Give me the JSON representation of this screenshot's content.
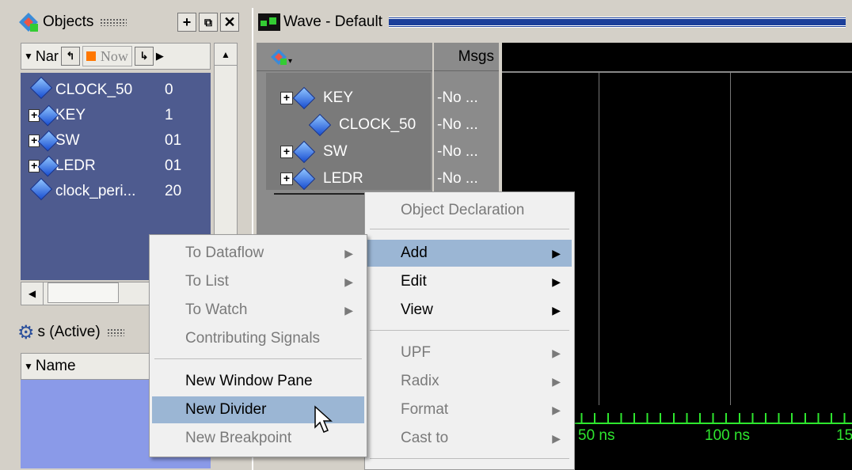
{
  "objects_panel": {
    "title": "Objects",
    "header": {
      "name_col": "Nar",
      "now_label": "Now"
    },
    "rows": [
      {
        "name": "CLOCK_50",
        "value": "0",
        "expandable": false
      },
      {
        "name": "KEY",
        "value": "1",
        "expandable": true
      },
      {
        "name": "SW",
        "value": "01",
        "expandable": true
      },
      {
        "name": "LEDR",
        "value": "01",
        "expandable": true
      },
      {
        "name": "clock_peri...",
        "value": "20",
        "expandable": false
      }
    ]
  },
  "processes_panel": {
    "title": "s (Active)",
    "header_name": "Name"
  },
  "wave_panel": {
    "title": "Wave - Default",
    "msgs_header": "Msgs",
    "signals": [
      {
        "name": "KEY",
        "value": "-No ...",
        "expandable": true
      },
      {
        "name": "CLOCK_50",
        "value": "-No ...",
        "expandable": false
      },
      {
        "name": "SW",
        "value": "-No ...",
        "expandable": true
      },
      {
        "name": "LEDR",
        "value": "-No ...",
        "expandable": true
      }
    ],
    "time_labels": [
      "50 ns",
      "100 ns",
      "15"
    ]
  },
  "main_menu": {
    "items": [
      {
        "label": "Object Declaration",
        "disabled": true,
        "submenu": false
      },
      {
        "label": "Add",
        "disabled": false,
        "submenu": true,
        "highlighted": true
      },
      {
        "label": "Edit",
        "disabled": false,
        "submenu": true
      },
      {
        "label": "View",
        "disabled": false,
        "submenu": true
      },
      {
        "label": "UPF",
        "disabled": true,
        "submenu": true
      },
      {
        "label": "Radix",
        "disabled": true,
        "submenu": true
      },
      {
        "label": "Format",
        "disabled": true,
        "submenu": true
      },
      {
        "label": "Cast to",
        "disabled": true,
        "submenu": true
      }
    ]
  },
  "add_submenu": {
    "items": [
      {
        "label": "To Dataflow",
        "disabled": true,
        "submenu": true
      },
      {
        "label": "To List",
        "disabled": true,
        "submenu": true
      },
      {
        "label": "To Watch",
        "disabled": true,
        "submenu": true
      },
      {
        "label": "Contributing Signals",
        "disabled": true,
        "submenu": false
      },
      {
        "label": "New Window Pane",
        "disabled": false,
        "submenu": false
      },
      {
        "label": "New Divider",
        "disabled": false,
        "submenu": false,
        "highlighted": true
      },
      {
        "label": "New Breakpoint",
        "disabled": true,
        "submenu": false
      }
    ]
  },
  "colors": {
    "objects_bg": "#4e5b8f",
    "wave_bg": "#000000",
    "menu_highlight": "#9bb6d4",
    "timeline_green": "#2ee62e"
  }
}
